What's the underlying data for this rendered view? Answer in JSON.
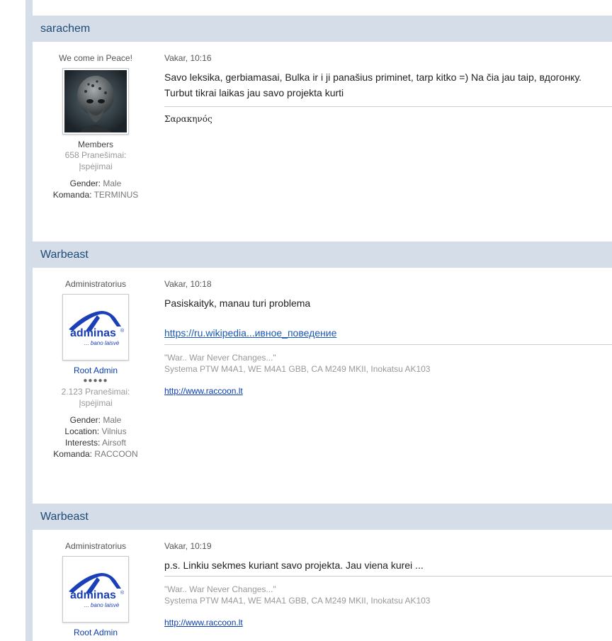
{
  "posts": [
    {
      "author": "sarachem",
      "title": "We come in Peace!",
      "rank": "Members",
      "posts_count": "658 Pranešimai:",
      "warnings": "Įspėjimai",
      "fields": [
        {
          "key": "Gender:",
          "value": "Male"
        },
        {
          "key": "Komanda:",
          "value": "TERMINUS"
        }
      ],
      "date": "Vakar, 10:16",
      "text": "Savo leksika, gerbiamasai, Bulka ir i ji panašius priminet, tarp kitko =) Na čia jau taip, вдогонку. Turbut tikrai laikas jau savo projekta kurti",
      "signature": "Σαρακηνός"
    },
    {
      "author": "Warbeast",
      "title": "Administratorius",
      "rank": "Root Admin",
      "pips": "●●●●●",
      "posts_count": "2.123 Pranešimai:",
      "warnings": "Įspėjimai",
      "fields": [
        {
          "key": "Gender:",
          "value": "Male"
        },
        {
          "key": "Location:",
          "value": "Vilnius"
        },
        {
          "key": "Interests:",
          "value": "Airsoft"
        },
        {
          "key": "Komanda:",
          "value": "RACCOON"
        }
      ],
      "date": "Vakar, 10:18",
      "text": "Pasiskaityk, manau turi problema",
      "link": "https://ru.wikipedia...ивное_поведение",
      "sig_quote": "\"War.. War Never Changes...\"",
      "sig_gear": "Systema PTW M4A1, WE M4A1 GBB, CA M249 MKII, Inokatsu AK103",
      "sig_link": "http://www.raccoon.lt"
    },
    {
      "author": "Warbeast",
      "title": "Administratorius",
      "rank": "Root Admin",
      "date": "Vakar, 10:19",
      "text": "p.s. Linkiu sekmes kuriant savo projekta. Jau viena kurei ...",
      "sig_quote": "\"War.. War Never Changes...\"",
      "sig_gear": "Systema PTW M4A1, WE M4A1 GBB, CA M249 MKII, Inokatsu AK103",
      "sig_link": "http://www.raccoon.lt"
    }
  ],
  "avatar_logo": {
    "brand": "adminas",
    "tagline": "... bano laisvė",
    "registered": "®"
  },
  "colors": {
    "header_bg": "#d5dde8",
    "author_link": "#1d4a77",
    "admin_rank": "#0a3db0"
  }
}
